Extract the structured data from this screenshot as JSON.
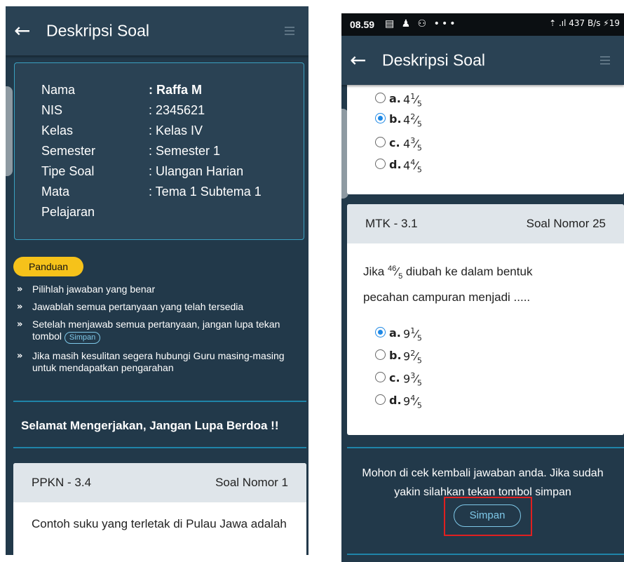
{
  "left": {
    "header": {
      "title": "Deskripsi Soal",
      "back": "←"
    },
    "info": [
      {
        "label": "Nama",
        "value": ": Raffa M"
      },
      {
        "label": "NIS",
        "value": ": 2345621"
      },
      {
        "label": "Kelas",
        "value": ": Kelas IV"
      },
      {
        "label": "Semester",
        "value": ": Semester 1"
      },
      {
        "label": "Tipe Soal",
        "value": ": Ulangan Harian"
      },
      {
        "label": "Mata",
        "value": ": Tema 1 Subtema 1"
      },
      {
        "label": "Pelajaran",
        "value": ""
      }
    ],
    "panduan_label": "Panduan",
    "guide": [
      {
        "text": "Pilihlah jawaban yang benar"
      },
      {
        "text": "Jawablah semua pertanyaan yang telah tersedia"
      },
      {
        "text": "Setelah menjawab semua pertanyaan, jangan lupa tekan tombol",
        "pill": "Simpan"
      },
      {
        "text": "Jika masih kesulitan segera hubungi Guru masing-masing untuk mendapatkan pengarahan"
      }
    ],
    "greeting": "Selamat Mengerjakan, Jangan Lupa Berdoa !!",
    "question_card": {
      "code": "PPKN - 3.4",
      "number": "Soal Nomor 1",
      "text": "Contoh suku yang terletak di Pulau Jawa adalah"
    }
  },
  "right": {
    "status": {
      "time": "08.59",
      "icons": "▤ ♟ ⚇ •••",
      "right": "⇡ .ıl 437 B/s ⚡19"
    },
    "header": {
      "title": "Deskripsi Soal",
      "back": "←"
    },
    "prev_options": [
      {
        "letter": "a.",
        "whole": "4",
        "num": "1",
        "den": "5",
        "selected": false
      },
      {
        "letter": "b.",
        "whole": "4",
        "num": "2",
        "den": "5",
        "selected": true
      },
      {
        "letter": "c.",
        "whole": "4",
        "num": "3",
        "den": "5",
        "selected": false
      },
      {
        "letter": "d.",
        "whole": "4",
        "num": "4",
        "den": "5",
        "selected": false
      }
    ],
    "question_card": {
      "code": "MTK - 3.1",
      "number": "Soal Nomor 25",
      "text_prefix": "Jika",
      "frac_num": "46",
      "frac_den": "5",
      "text_rest": "diubah ke dalam bentuk",
      "text_line2": "pecahan campuran menjadi .....",
      "options": [
        {
          "letter": "a.",
          "whole": "9",
          "num": "1",
          "den": "5",
          "selected": true
        },
        {
          "letter": "b.",
          "whole": "9",
          "num": "2",
          "den": "5",
          "selected": false
        },
        {
          "letter": "c.",
          "whole": "9",
          "num": "3",
          "den": "5",
          "selected": false
        },
        {
          "letter": "d.",
          "whole": "9",
          "num": "4",
          "den": "5",
          "selected": false
        }
      ]
    },
    "note_line1": "Mohon di cek kembali jawaban anda. Jika sudah",
    "note_line2": "yakin silahkan tekan tombol simpan",
    "save_label": "Simpan"
  },
  "colors": {
    "bg": "#22394a",
    "appbar": "#2a4254",
    "accent": "#1f84a8",
    "panduan": "#f6c21a",
    "radio": "#1e88e5",
    "highlight": "#e02020"
  }
}
